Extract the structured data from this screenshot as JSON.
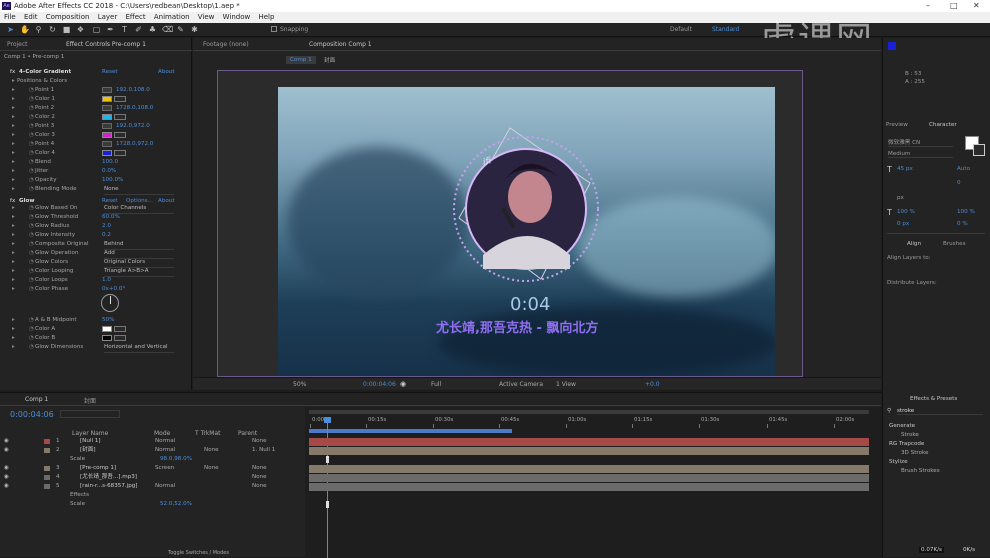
{
  "title_bar": {
    "title": "Adobe After Effects CC 2018 - C:\\Users\\redbean\\Desktop\\1.aep *"
  },
  "menu": [
    "File",
    "Edit",
    "Composition",
    "Layer",
    "Effect",
    "Animation",
    "View",
    "Window",
    "Help"
  ],
  "toolbar": {
    "snapping_label": "Snapping",
    "workspaces": [
      "Default",
      "Standard"
    ],
    "watermark": "虎课网"
  },
  "project_panel": {
    "tab": "Project"
  },
  "effect_controls": {
    "tab": "Effect Controls Pre-comp 1",
    "breadcrumb": "Comp 1 • Pre-comp 1",
    "effects": [
      {
        "name": "4-Color Gradient",
        "reset": "Reset",
        "about": "About"
      },
      {
        "name": "Glow",
        "reset": "Reset",
        "options": "Options...",
        "about": "About"
      }
    ],
    "rows": [
      {
        "label": "Positions & Colors",
        "indent": 1
      },
      {
        "label": "Point 1",
        "value": "192.0,108.0",
        "kind": "point"
      },
      {
        "label": "Color 1",
        "kind": "color",
        "color": "#e9c30f"
      },
      {
        "label": "Point 2",
        "value": "1728.0,108.0",
        "kind": "point"
      },
      {
        "label": "Color 2",
        "kind": "color",
        "color": "#21b6e9"
      },
      {
        "label": "Point 3",
        "value": "192.0,972.0",
        "kind": "point"
      },
      {
        "label": "Color 3",
        "kind": "color",
        "color": "#d223c8"
      },
      {
        "label": "Point 4",
        "value": "1728.0,972.0",
        "kind": "point"
      },
      {
        "label": "Color 4",
        "kind": "color",
        "color": "#1a1fd8"
      },
      {
        "label": "Blend",
        "value": "100.0"
      },
      {
        "label": "Jitter",
        "value": "0.0%"
      },
      {
        "label": "Opacity",
        "value": "100.0%"
      },
      {
        "label": "Blending Mode",
        "dropdown": "None"
      },
      {
        "label": "Glow Based On",
        "dropdown": "Color Channels"
      },
      {
        "label": "Glow Threshold",
        "value": "60.0%"
      },
      {
        "label": "Glow Radius",
        "value": "2.0"
      },
      {
        "label": "Glow Intensity",
        "value": "0.2"
      },
      {
        "label": "Composite Original",
        "dropdown": "Behind"
      },
      {
        "label": "Glow Operation",
        "dropdown": "Add"
      },
      {
        "label": "Glow Colors",
        "dropdown": "Original Colors"
      },
      {
        "label": "Color Looping",
        "dropdown": "Triangle A>B>A"
      },
      {
        "label": "Color Loops",
        "value": "1.0"
      },
      {
        "label": "Color Phase",
        "value": "0x+0.0°"
      },
      {
        "label": "A & B Midpoint",
        "value": "50%"
      },
      {
        "label": "Color A",
        "kind": "color",
        "color": "#ffffff"
      },
      {
        "label": "Color B",
        "kind": "color",
        "color": "#000000"
      },
      {
        "label": "Glow Dimensions",
        "dropdown": "Horizontal and Vertical"
      }
    ]
  },
  "viewer": {
    "footage_tab": "Footage (none)",
    "comp_tab": "Composition Comp 1",
    "comp_subtabs": [
      "Comp 1",
      "封面"
    ],
    "overlay_time": "0:04",
    "overlay_caption": "尤长靖,那吾克热 - 飘向北方",
    "ring_text": "ifi",
    "footer": {
      "zoom": "50%",
      "timecode": "0:00:04:06",
      "resolution": "Full",
      "camera": "Active Camera",
      "view": "1 View",
      "exposure": "+0.0"
    }
  },
  "timeline": {
    "tabs": [
      "Comp 1",
      "封面"
    ],
    "timecode": "0:00:04:06",
    "columns": [
      "Layer Name",
      "Mode",
      "T TrkMat",
      "Parent"
    ],
    "ruler": [
      "0:00s",
      "00:15s",
      "00:30s",
      "00:45s",
      "01:00s",
      "01:15s",
      "01:30s",
      "01:45s",
      "02:00s"
    ],
    "layers": [
      {
        "num": "1",
        "name": "[Null 1]",
        "mode": "Normal",
        "trk": "",
        "parent": "None",
        "color": "#a64a47"
      },
      {
        "num": "2",
        "name": "[封面]",
        "mode": "Normal",
        "trk": "None",
        "parent": "1. Null 1",
        "color": "#857a6a"
      },
      {
        "num": "",
        "name": "Scale",
        "value": "98.0,98.0%",
        "prop": true
      },
      {
        "num": "3",
        "name": "[Pre-comp 1]",
        "mode": "Screen",
        "trk": "None",
        "parent": "None",
        "color": "#857a6a"
      },
      {
        "num": "4",
        "name": "[尤长靖_那吾...].mp3]",
        "mode": "",
        "trk": "",
        "parent": "None",
        "color": "#6b6b6b"
      },
      {
        "num": "5",
        "name": "[rain-r...s-68357.jpg]",
        "mode": "Normal",
        "trk": "",
        "parent": "None",
        "color": "#6b6b6b"
      },
      {
        "num": "",
        "name": "Effects",
        "prop": true
      },
      {
        "num": "",
        "name": "Scale",
        "value": "52.0,52.0%",
        "prop": true
      }
    ],
    "bottom_label": "Toggle Switches / Modes"
  },
  "right_panel": {
    "info": {
      "B": "B : 53",
      "A": "A : 255"
    },
    "preview_tab": "Preview",
    "character_tab": "Character",
    "font": "微软雅黑 CN",
    "style": "Medium",
    "size": "45 px",
    "leading": "Auto",
    "tracking": "0",
    "kerning": "px",
    "vscale": "100 %",
    "hscale": "100 %",
    "baseline": "0 px",
    "tsume": "0 %",
    "align_tab": "Align",
    "brushes_tab": "Brushes",
    "align_layers_to": "Align Layers to:",
    "distribute_layers": "Distribute Layers:",
    "effects_presets_tab": "Effects & Presets",
    "search_value": "stroke",
    "tree": [
      {
        "label": "Generate",
        "level": 0
      },
      {
        "label": "Stroke",
        "level": 1
      },
      {
        "label": "RG Trapcode",
        "level": 0
      },
      {
        "label": "3D Stroke",
        "level": 1
      },
      {
        "label": "Stylize",
        "level": 0
      },
      {
        "label": "Brush Strokes",
        "level": 1
      }
    ],
    "status": {
      "speed": "0.07K/s",
      "other": "0K/s"
    }
  }
}
